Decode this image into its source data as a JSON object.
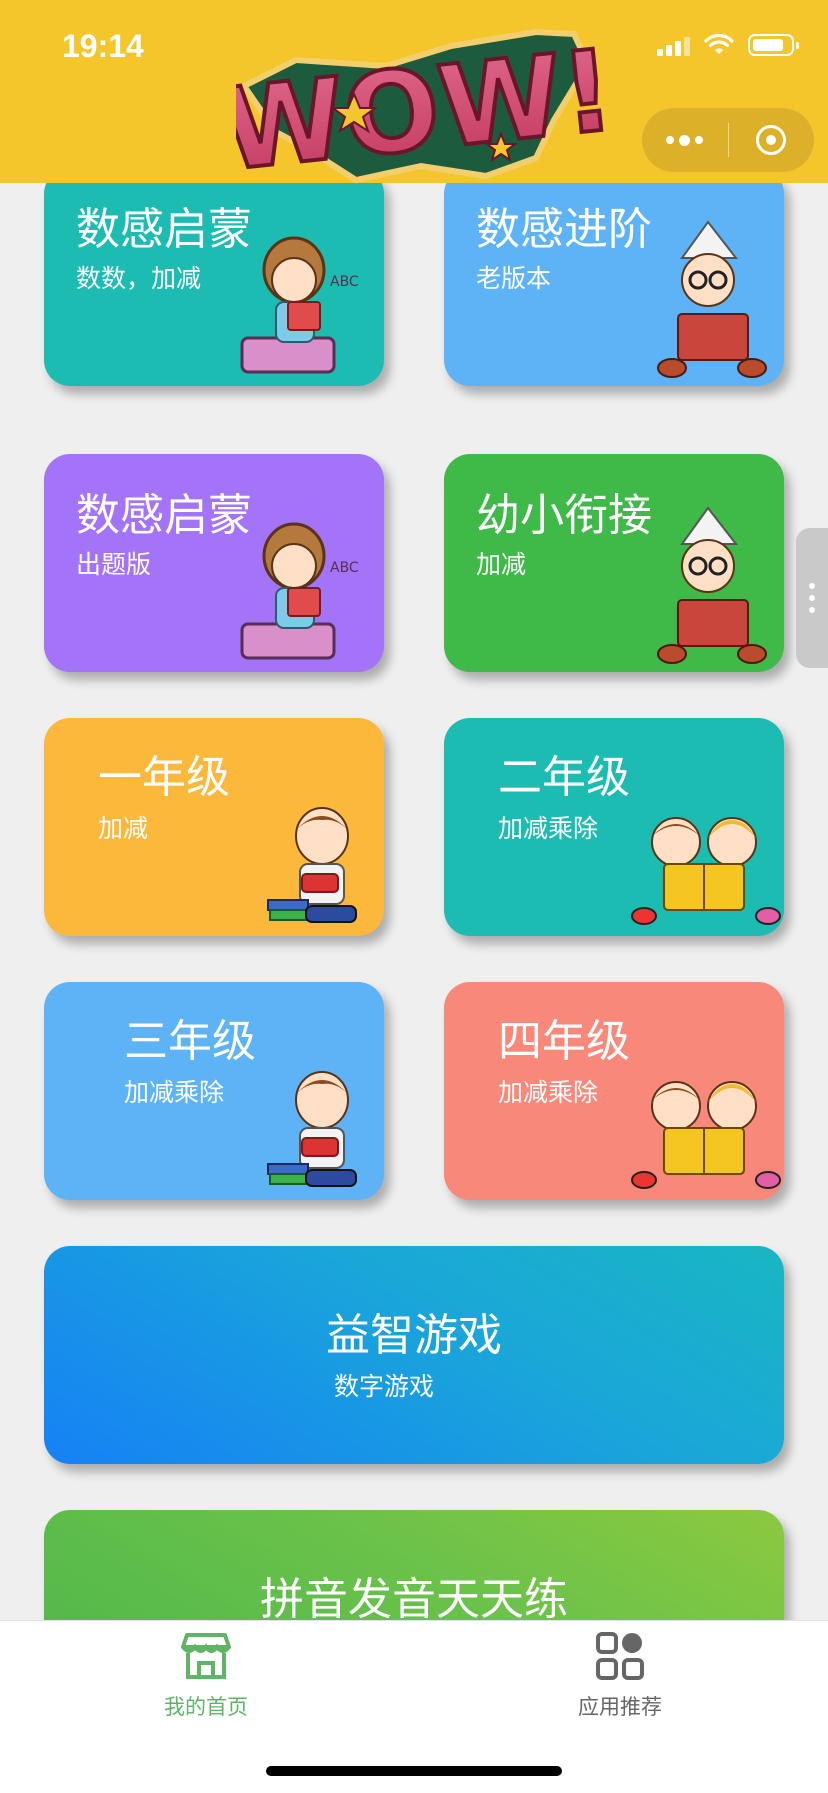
{
  "status": {
    "time": "19:14"
  },
  "cards": [
    {
      "title": "数感启蒙",
      "subtitle": "数数，加减",
      "illustration": "girl-reading-abc"
    },
    {
      "title": "数感进阶",
      "subtitle": "老版本",
      "illustration": "boy-paper-hat-reading"
    },
    {
      "title": "数感启蒙",
      "subtitle": "出题版",
      "illustration": "girl-reading-abc"
    },
    {
      "title": "幼小衔接",
      "subtitle": "加减",
      "illustration": "boy-paper-hat-reading"
    },
    {
      "title": "一年级",
      "subtitle": "加减",
      "illustration": "boy-with-books"
    },
    {
      "title": "二年级",
      "subtitle": "加减乘除",
      "illustration": "two-kids-reading"
    },
    {
      "title": "三年级",
      "subtitle": "加减乘除",
      "illustration": "boy-with-books"
    },
    {
      "title": "四年级",
      "subtitle": "加减乘除",
      "illustration": "two-kids-reading"
    },
    {
      "title": "益智游戏",
      "subtitle": "数字游戏"
    },
    {
      "title": "拼音发音天天练"
    }
  ],
  "colors": {
    "header": "#f4c62b",
    "teal": "#1dbcb3",
    "sky": "#5db3f5",
    "purple": "#a374f7",
    "green": "#3fba48",
    "orange": "#fbb83a",
    "salmon": "#f7887a",
    "tab_active": "#5fb465",
    "tab_inactive": "#666666"
  },
  "tabbar": [
    {
      "label": "我的首页",
      "icon": "home-shop-icon",
      "active": true
    },
    {
      "label": "应用推荐",
      "icon": "apps-grid-icon",
      "active": false
    }
  ]
}
